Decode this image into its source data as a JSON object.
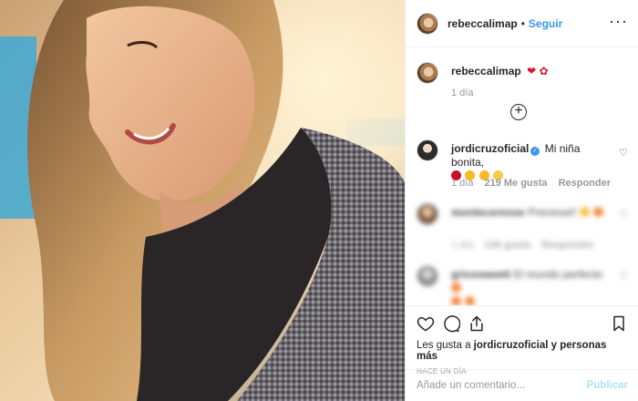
{
  "post": {
    "author": "rebeccalimap",
    "dot": "•",
    "follow_label": "Seguir",
    "more_icon": "more-options-icon"
  },
  "caption": {
    "username": "rebeccalimap",
    "emojis": [
      "red-heart",
      "rose"
    ],
    "time": "1 día"
  },
  "comments": [
    {
      "username": "jordicruzoficial",
      "verified": true,
      "text": "Mi niña bonita,",
      "emojis": [
        "rose",
        "heart-eyes-face",
        "heart-eyes-face",
        "kissing-face"
      ],
      "time": "1 día",
      "likes": "219 Me gusta",
      "reply_label": "Responder"
    },
    {
      "username": "monteceresse",
      "text": "Preciosa!!",
      "time": "1 día",
      "likes": "136 gusta",
      "reply_label": "Responder",
      "blurred": true
    },
    {
      "username": "gricesweeti",
      "text": "El mundo perfecto",
      "blurred": true
    }
  ],
  "actions": {
    "likes_prefix": "Les gusta a",
    "likes_user": "jordicruzoficial",
    "likes_suffix": "y personas más",
    "timestamp": "HACE UN DÍA"
  },
  "add_comment": {
    "placeholder": "Añade un comentario...",
    "publish_label": "Publicar"
  },
  "colors": {
    "link": "#3897f0",
    "publish_disabled": "#b2dffc",
    "heart_red": "#ed4956"
  }
}
